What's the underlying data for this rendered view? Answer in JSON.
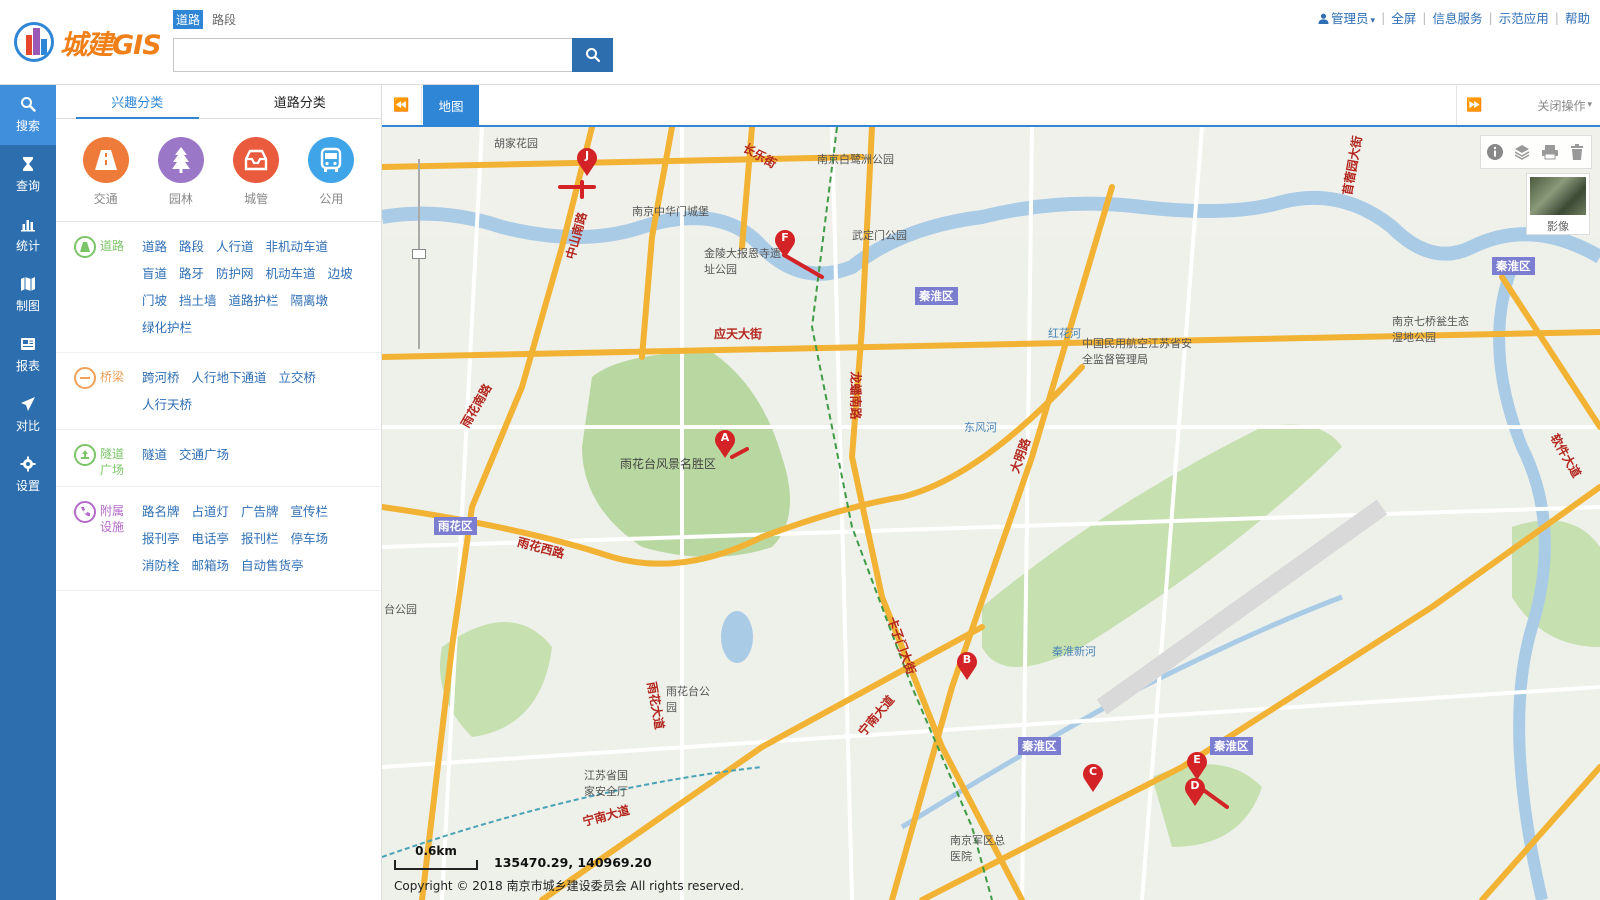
{
  "app": {
    "logo_text": "城建GIS"
  },
  "search": {
    "tabs": [
      "道路",
      "路段"
    ],
    "active_tab": 0,
    "placeholder": "",
    "value": ""
  },
  "top_links": {
    "user": "管理员",
    "fullscreen": "全屏",
    "info": "信息服务",
    "demo": "示范应用",
    "help": "帮助"
  },
  "leftbar": [
    {
      "label": "搜索",
      "icon": "search-icon"
    },
    {
      "label": "查询",
      "icon": "hourglass-icon"
    },
    {
      "label": "统计",
      "icon": "bar-chart-icon"
    },
    {
      "label": "制图",
      "icon": "map-icon"
    },
    {
      "label": "报表",
      "icon": "report-icon"
    },
    {
      "label": "对比",
      "icon": "send-icon"
    },
    {
      "label": "设置",
      "icon": "gear-icon"
    }
  ],
  "panel": {
    "tabs": [
      "兴趣分类",
      "道路分类"
    ],
    "categories": [
      {
        "label": "交通",
        "color": "#ee7b3a",
        "icon": "road-icon"
      },
      {
        "label": "园林",
        "color": "#9b77c7",
        "icon": "tree-icon"
      },
      {
        "label": "城管",
        "color": "#ea5a3c",
        "icon": "city-icon"
      },
      {
        "label": "公用",
        "color": "#3fa4e8",
        "icon": "bus-icon"
      }
    ],
    "groups": [
      {
        "name": "道路",
        "color": "#7bc467",
        "items": [
          "道路",
          "路段",
          "人行道",
          "非机动车道",
          "盲道",
          "路牙",
          "防护网",
          "机动车道",
          "边坡",
          "门坡",
          "挡土墙",
          "道路护栏",
          "隔离墩",
          "绿化护栏"
        ]
      },
      {
        "name": "桥梁",
        "color": "#f0a25a",
        "items": [
          "跨河桥",
          "人行地下通道",
          "立交桥",
          "人行天桥"
        ]
      },
      {
        "name": "隧道广场",
        "color": "#7bc467",
        "items": [
          "隧道",
          "交通广场"
        ]
      },
      {
        "name": "附属设施",
        "color": "#b36ac9",
        "items": [
          "路名牌",
          "占道灯",
          "广告牌",
          "宣传栏",
          "报刊亭",
          "电话亭",
          "报刊栏",
          "停车场",
          "消防栓",
          "邮箱场",
          "自动售货亭"
        ]
      }
    ]
  },
  "map_toolbar": {
    "tab": "地图",
    "close_label": "关闭操作"
  },
  "map": {
    "imagery_label": "影像",
    "scale_label": "0.6km",
    "coords": "135470.29, 140969.20",
    "copyright": "Copyright © 2018 南京市城乡建设委员会 All rights reserved.",
    "markers": [
      "J",
      "F",
      "A",
      "B",
      "C",
      "E",
      "D"
    ],
    "districts": [
      "秦淮区",
      "秦淮区",
      "雨花区",
      "秦淮区",
      "秦淮区"
    ],
    "place_labels": [
      "胡家花园",
      "南京中华门城堡",
      "南京白鹭洲公园",
      "金陵大报恩寺遗址公园",
      "武定门公园",
      "雨花台风景名胜区",
      "中国民用航空江苏省安全监督管理局",
      "南京七桥瓮生态湿地公园",
      "东风河",
      "台公园",
      "雨花台公园",
      "江苏省国家安全厅",
      "南京军区总医院",
      "红花河",
      "秦淮新河"
    ],
    "road_labels": [
      "应天大街",
      "雨花南路",
      "中山南路",
      "雨花西路",
      "大明路",
      "龙蟠南路",
      "雨花大道",
      "宁南大道",
      "卡子门大街",
      "宁南大道",
      "长乐街",
      "软件大道",
      "苜蓿园大街"
    ]
  },
  "colors": {
    "primary": "#2d6fae",
    "accent": "#2f86d6",
    "road_major": "#f2b233",
    "water": "#a9cbe6",
    "park": "#bcd9a4",
    "marker": "#d42326"
  }
}
